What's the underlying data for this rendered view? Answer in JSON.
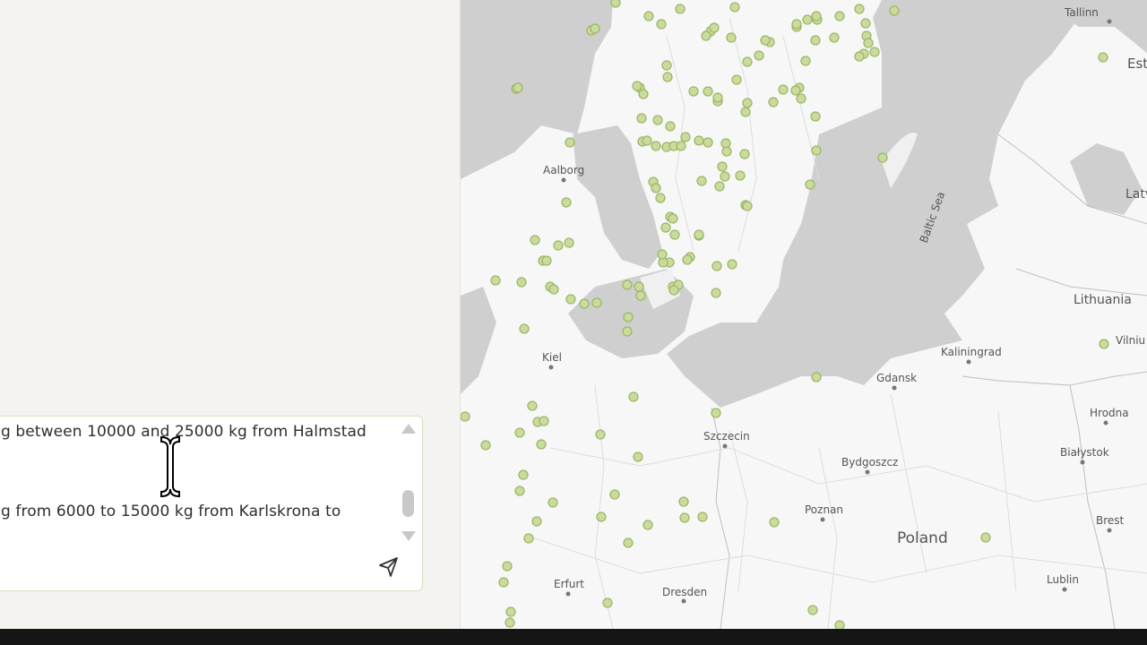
{
  "chat": {
    "message_line_1": "g between 10000 and 25000 kg from Halmstad",
    "message_line_2": "g from 6000 to 15000 kg from Karlskrona to",
    "send_icon": "send-icon"
  },
  "map": {
    "marker_color": "#c9dc9c",
    "marker_stroke": "#9fb56a",
    "water_color": "#cfcfcf",
    "land_color": "#f7f7f7",
    "labels": {
      "tallinn": "Tallinn",
      "estonia": "Est",
      "latvia": "Latvi",
      "lithuania": "Lithuania",
      "vilnius": "Vilniu",
      "baltic_sea": "Baltic Sea",
      "aalborg": "Aalborg",
      "kiel": "Kiel",
      "kaliningrad": "Kaliningrad",
      "gdansk": "Gdansk",
      "szczecin": "Szczecin",
      "bydgoszcz": "Bydgoszcz",
      "hrodna": "Hrodna",
      "bialystok": "Białystok",
      "poznan": "Poznan",
      "poland": "Poland",
      "brest": "Brest",
      "lublin": "Lublin",
      "erfurt": "Erfurt",
      "dresden": "Dresden"
    }
  }
}
